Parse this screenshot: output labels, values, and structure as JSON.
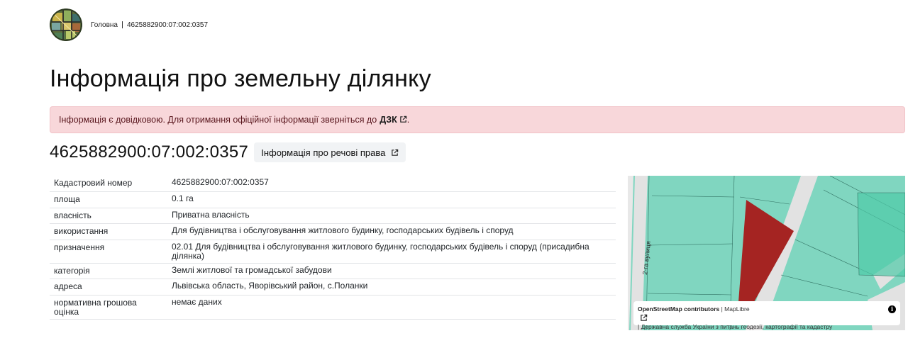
{
  "breadcrumb": {
    "home": "Головна",
    "current": "4625882900:07:002:0357"
  },
  "page_title": "Інформація про земельну ділянку",
  "alert": {
    "text": "Інформація є довідковою. Для отримання офіційної інформації зверніться до",
    "link": "ДЗК",
    "end": ".",
    "background": "#f8d7da"
  },
  "parcel": {
    "id": "4625882900:07:002:0357",
    "rights_button": "Інформація про речові права"
  },
  "table": [
    {
      "key": "Кадастровий номер",
      "value": "4625882900:07:002:0357"
    },
    {
      "key": "площа",
      "value": "0.1 га"
    },
    {
      "key": "власність",
      "value": "Приватна власність"
    },
    {
      "key": "використання",
      "value": "Для будівництва і обслуговування житлового будинку, господарських будівель і споруд"
    },
    {
      "key": "призначення",
      "value": "02.01 Для будівництва і обслуговування житлового будинку, господарських будівель і споруд (присадибна ділянка)"
    },
    {
      "key": "категорія",
      "value": "Землі житлової та громадської забудови"
    },
    {
      "key": "адреса",
      "value": "Львівська область, Яворівський район, с.Поланки"
    },
    {
      "key": "нормативна грошова оцінка",
      "value": "немає даних"
    }
  ],
  "map": {
    "street_label": "2-га вулиця",
    "parcel_color": "#a52422",
    "land_color": "#80d6c0",
    "attribution": {
      "osm": "OpenStreetMap contributors",
      "maplibre": "MapLibre",
      "agency": "Державна служба України з питань геодезії, картографії та кадастру"
    },
    "info_icon": "i"
  }
}
